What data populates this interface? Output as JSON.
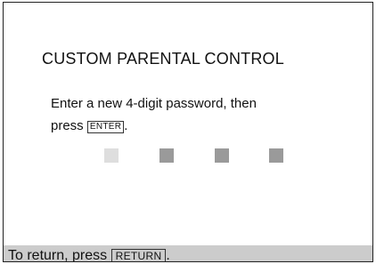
{
  "title": "CUSTOM PARENTAL CONTROL",
  "message": {
    "line1": "Enter a new 4-digit password, then",
    "line2_prefix": "press ",
    "enter_key": "ENTER",
    "line2_suffix": "."
  },
  "password_entry": {
    "digit_count": 4,
    "active_index": 0,
    "digit_colors": {
      "active": "#dedede",
      "inactive": "#9a9a9a"
    }
  },
  "footer": {
    "prefix": "To return, press ",
    "return_key": "RETURN",
    "suffix": ".",
    "background": "#cccccc"
  }
}
